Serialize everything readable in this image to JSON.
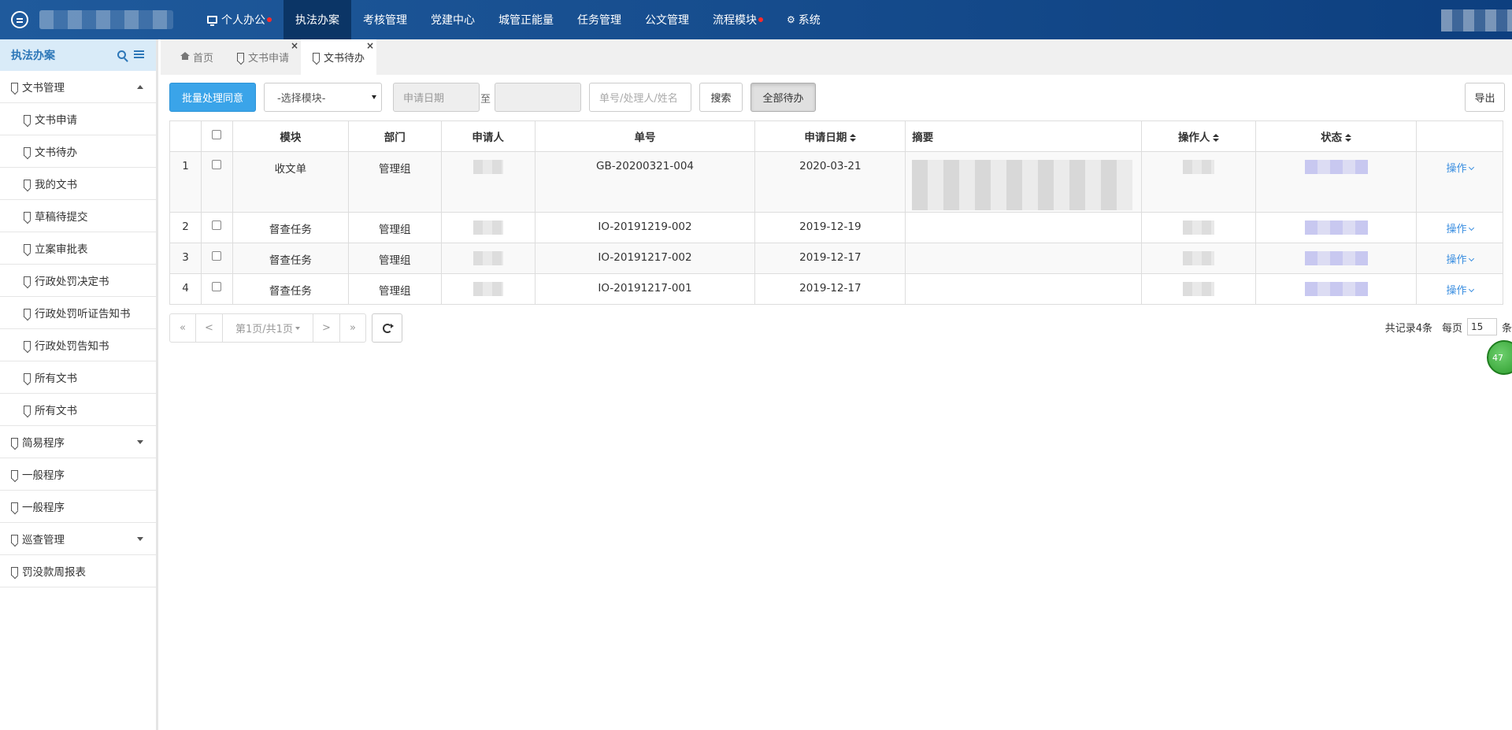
{
  "nav": {
    "items": [
      {
        "label": "个人办公"
      },
      {
        "label": "执法办案"
      },
      {
        "label": "考核管理"
      },
      {
        "label": "党建中心"
      },
      {
        "label": "城管正能量"
      },
      {
        "label": "任务管理"
      },
      {
        "label": "公文管理"
      },
      {
        "label": "流程模块"
      },
      {
        "label": "系统"
      }
    ]
  },
  "sidebar": {
    "title": "执法办案",
    "items": [
      {
        "label": "文书管理"
      },
      {
        "label": "文书申请"
      },
      {
        "label": "文书待办"
      },
      {
        "label": "我的文书"
      },
      {
        "label": "草稿待提交"
      },
      {
        "label": "立案审批表"
      },
      {
        "label": "行政处罚决定书"
      },
      {
        "label": "行政处罚听证告知书"
      },
      {
        "label": "行政处罚告知书"
      },
      {
        "label": "所有文书"
      },
      {
        "label": "所有文书"
      },
      {
        "label": "简易程序"
      },
      {
        "label": "一般程序"
      },
      {
        "label": "一般程序"
      },
      {
        "label": "巡查管理"
      },
      {
        "label": "罚没款周报表"
      }
    ]
  },
  "tabs": [
    {
      "label": "首页"
    },
    {
      "label": "文书申请"
    },
    {
      "label": "文书待办"
    }
  ],
  "toolbar": {
    "batch_label": "批量处理同意",
    "module_select": "-选择模块-",
    "date_start_placeholder": "申请日期",
    "to_label": "至",
    "search_placeholder": "单号/处理人/姓名",
    "search_label": "搜索",
    "all_todo_label": "全部待办",
    "export_label": "导出"
  },
  "table": {
    "headers": [
      "模块",
      "部门",
      "申请人",
      "单号",
      "申请日期",
      "摘要",
      "操作人",
      "状态"
    ],
    "rows": [
      {
        "index": "1",
        "module": "收文单",
        "dept": "管理组",
        "no": "GB-20200321-004",
        "date": "2020-03-21",
        "op": "操作"
      },
      {
        "index": "2",
        "module": "督查任务",
        "dept": "管理组",
        "no": "IO-20191219-002",
        "date": "2019-12-19",
        "op": "操作"
      },
      {
        "index": "3",
        "module": "督查任务",
        "dept": "管理组",
        "no": "IO-20191217-002",
        "date": "2019-12-17",
        "op": "操作"
      },
      {
        "index": "4",
        "module": "督查任务",
        "dept": "管理组",
        "no": "IO-20191217-001",
        "date": "2019-12-17",
        "op": "操作"
      }
    ]
  },
  "pager": {
    "first": "«",
    "prev": "<",
    "page_info": "第1页/共1页",
    "next": ">",
    "last": "»",
    "total": "共记录4条",
    "per_page_label": "每页",
    "per_page_value": "15",
    "unit": "条"
  },
  "badge": {
    "value": "47"
  }
}
